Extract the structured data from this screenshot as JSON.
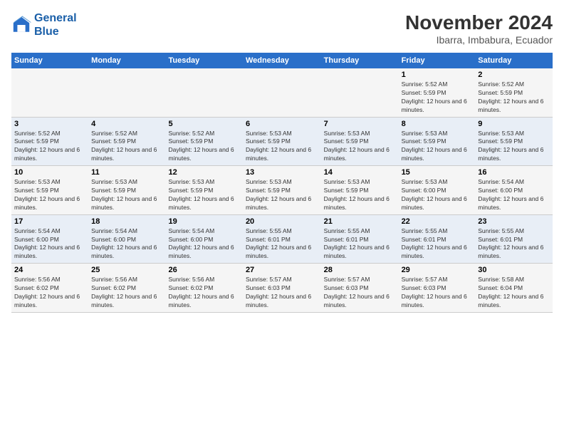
{
  "logo": {
    "line1": "General",
    "line2": "Blue"
  },
  "title": "November 2024",
  "subtitle": "Ibarra, Imbabura, Ecuador",
  "days_of_week": [
    "Sunday",
    "Monday",
    "Tuesday",
    "Wednesday",
    "Thursday",
    "Friday",
    "Saturday"
  ],
  "weeks": [
    [
      {
        "day": "",
        "info": ""
      },
      {
        "day": "",
        "info": ""
      },
      {
        "day": "",
        "info": ""
      },
      {
        "day": "",
        "info": ""
      },
      {
        "day": "",
        "info": ""
      },
      {
        "day": "1",
        "info": "Sunrise: 5:52 AM\nSunset: 5:59 PM\nDaylight: 12 hours and 6 minutes."
      },
      {
        "day": "2",
        "info": "Sunrise: 5:52 AM\nSunset: 5:59 PM\nDaylight: 12 hours and 6 minutes."
      }
    ],
    [
      {
        "day": "3",
        "info": "Sunrise: 5:52 AM\nSunset: 5:59 PM\nDaylight: 12 hours and 6 minutes."
      },
      {
        "day": "4",
        "info": "Sunrise: 5:52 AM\nSunset: 5:59 PM\nDaylight: 12 hours and 6 minutes."
      },
      {
        "day": "5",
        "info": "Sunrise: 5:52 AM\nSunset: 5:59 PM\nDaylight: 12 hours and 6 minutes."
      },
      {
        "day": "6",
        "info": "Sunrise: 5:53 AM\nSunset: 5:59 PM\nDaylight: 12 hours and 6 minutes."
      },
      {
        "day": "7",
        "info": "Sunrise: 5:53 AM\nSunset: 5:59 PM\nDaylight: 12 hours and 6 minutes."
      },
      {
        "day": "8",
        "info": "Sunrise: 5:53 AM\nSunset: 5:59 PM\nDaylight: 12 hours and 6 minutes."
      },
      {
        "day": "9",
        "info": "Sunrise: 5:53 AM\nSunset: 5:59 PM\nDaylight: 12 hours and 6 minutes."
      }
    ],
    [
      {
        "day": "10",
        "info": "Sunrise: 5:53 AM\nSunset: 5:59 PM\nDaylight: 12 hours and 6 minutes."
      },
      {
        "day": "11",
        "info": "Sunrise: 5:53 AM\nSunset: 5:59 PM\nDaylight: 12 hours and 6 minutes."
      },
      {
        "day": "12",
        "info": "Sunrise: 5:53 AM\nSunset: 5:59 PM\nDaylight: 12 hours and 6 minutes."
      },
      {
        "day": "13",
        "info": "Sunrise: 5:53 AM\nSunset: 5:59 PM\nDaylight: 12 hours and 6 minutes."
      },
      {
        "day": "14",
        "info": "Sunrise: 5:53 AM\nSunset: 5:59 PM\nDaylight: 12 hours and 6 minutes."
      },
      {
        "day": "15",
        "info": "Sunrise: 5:53 AM\nSunset: 6:00 PM\nDaylight: 12 hours and 6 minutes."
      },
      {
        "day": "16",
        "info": "Sunrise: 5:54 AM\nSunset: 6:00 PM\nDaylight: 12 hours and 6 minutes."
      }
    ],
    [
      {
        "day": "17",
        "info": "Sunrise: 5:54 AM\nSunset: 6:00 PM\nDaylight: 12 hours and 6 minutes."
      },
      {
        "day": "18",
        "info": "Sunrise: 5:54 AM\nSunset: 6:00 PM\nDaylight: 12 hours and 6 minutes."
      },
      {
        "day": "19",
        "info": "Sunrise: 5:54 AM\nSunset: 6:00 PM\nDaylight: 12 hours and 6 minutes."
      },
      {
        "day": "20",
        "info": "Sunrise: 5:55 AM\nSunset: 6:01 PM\nDaylight: 12 hours and 6 minutes."
      },
      {
        "day": "21",
        "info": "Sunrise: 5:55 AM\nSunset: 6:01 PM\nDaylight: 12 hours and 6 minutes."
      },
      {
        "day": "22",
        "info": "Sunrise: 5:55 AM\nSunset: 6:01 PM\nDaylight: 12 hours and 6 minutes."
      },
      {
        "day": "23",
        "info": "Sunrise: 5:55 AM\nSunset: 6:01 PM\nDaylight: 12 hours and 6 minutes."
      }
    ],
    [
      {
        "day": "24",
        "info": "Sunrise: 5:56 AM\nSunset: 6:02 PM\nDaylight: 12 hours and 6 minutes."
      },
      {
        "day": "25",
        "info": "Sunrise: 5:56 AM\nSunset: 6:02 PM\nDaylight: 12 hours and 6 minutes."
      },
      {
        "day": "26",
        "info": "Sunrise: 5:56 AM\nSunset: 6:02 PM\nDaylight: 12 hours and 6 minutes."
      },
      {
        "day": "27",
        "info": "Sunrise: 5:57 AM\nSunset: 6:03 PM\nDaylight: 12 hours and 6 minutes."
      },
      {
        "day": "28",
        "info": "Sunrise: 5:57 AM\nSunset: 6:03 PM\nDaylight: 12 hours and 6 minutes."
      },
      {
        "day": "29",
        "info": "Sunrise: 5:57 AM\nSunset: 6:03 PM\nDaylight: 12 hours and 6 minutes."
      },
      {
        "day": "30",
        "info": "Sunrise: 5:58 AM\nSunset: 6:04 PM\nDaylight: 12 hours and 6 minutes."
      }
    ]
  ]
}
